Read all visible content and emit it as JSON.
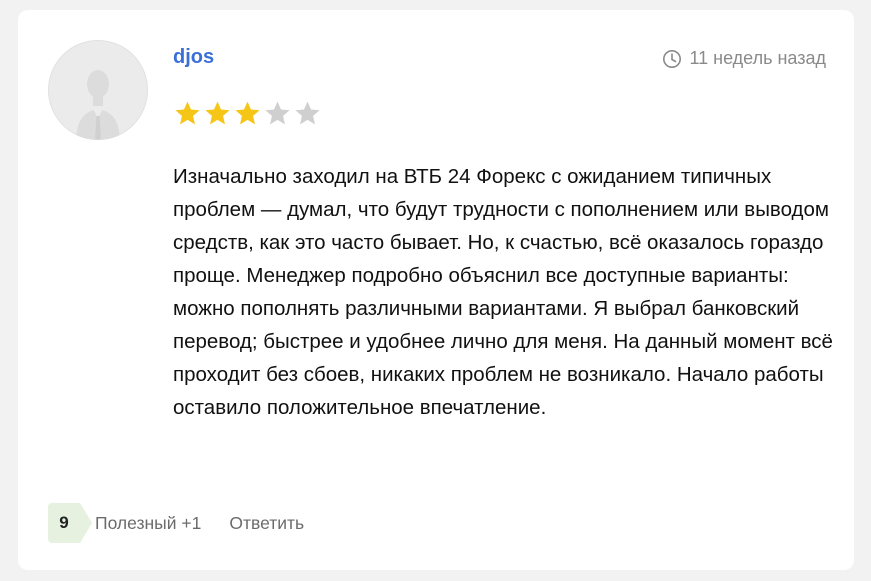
{
  "review": {
    "author": "djos",
    "time_ago": "11 недель назад",
    "rating": 3,
    "rating_max": 5,
    "text": "Изначально заходил на ВТБ 24 Форекс с ожиданием типичных проблем — думал, что будут трудности с пополнением или выводом средств, как это часто бывает. Но, к счастью, всё оказалось гораздо проще. Менеджер подробно объяснил все доступные варианты: можно пополнять различными вариантами. Я выбрал банковский перевод; быстрее и удобнее лично для меня. На данный момент всё проходит без сбоев, никаких проблем не возникало. Начало работы оставило положительное впечатление."
  },
  "footer": {
    "vote_count": "9",
    "useful_label": "Полезный +1",
    "reply_label": "Ответить"
  },
  "colors": {
    "star_filled": "#f5c518",
    "star_empty": "#cfcfcf",
    "author_link": "#3b6fd8",
    "badge_bg": "#e6f1df"
  },
  "icons": {
    "avatar": "user-silhouette-icon",
    "time": "clock-icon",
    "rating": "star-icon"
  }
}
